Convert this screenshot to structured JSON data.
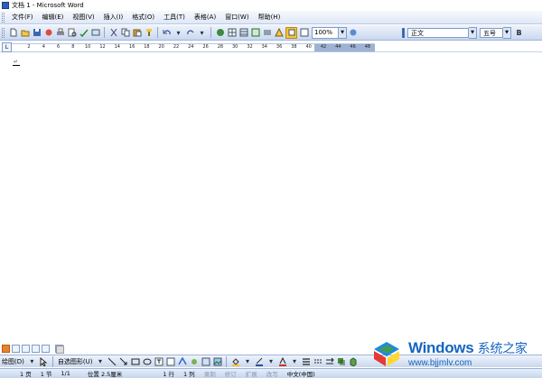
{
  "window": {
    "title": "文档 1 - Microsoft Word"
  },
  "menu": {
    "items": [
      "文件(F)",
      "编辑(E)",
      "视图(V)",
      "插入(I)",
      "格式(O)",
      "工具(T)",
      "表格(A)",
      "窗口(W)",
      "帮助(H)"
    ]
  },
  "toolbar": {
    "zoom": "100%",
    "style": "正文",
    "font": "宋体",
    "size": "五号",
    "bold": "B",
    "colors": {
      "highlight": "#f7c23c",
      "accent": "#e9822c"
    }
  },
  "ruler": {
    "corner": "L",
    "ticks": [
      "2",
      "4",
      "6",
      "8",
      "10",
      "12",
      "14",
      "16",
      "18",
      "20",
      "22",
      "24",
      "26",
      "28",
      "30",
      "32",
      "34",
      "36",
      "38",
      "40",
      "42",
      "44",
      "46",
      "48"
    ]
  },
  "document": {
    "paragraph_mark": "↵"
  },
  "drawing": {
    "draw_label": "绘图(D)",
    "autoshapes_label": "自选图形(U)"
  },
  "status": {
    "page": "1 页",
    "section": "1 节",
    "pages": "1/1",
    "position": "位置 2.5厘米",
    "line": "1 行",
    "column": "1 列",
    "rec": "录制",
    "trk": "修订",
    "ext": "扩展",
    "ovr": "改写",
    "language": "中文(中国)"
  },
  "watermark": {
    "brand": "Windows",
    "brand_suffix": "系统之家",
    "url": "www.bjjmlv.com",
    "colors": {
      "red": "#e53935",
      "green": "#43a047",
      "blue": "#1e88e5",
      "yellow": "#fdd835"
    }
  }
}
